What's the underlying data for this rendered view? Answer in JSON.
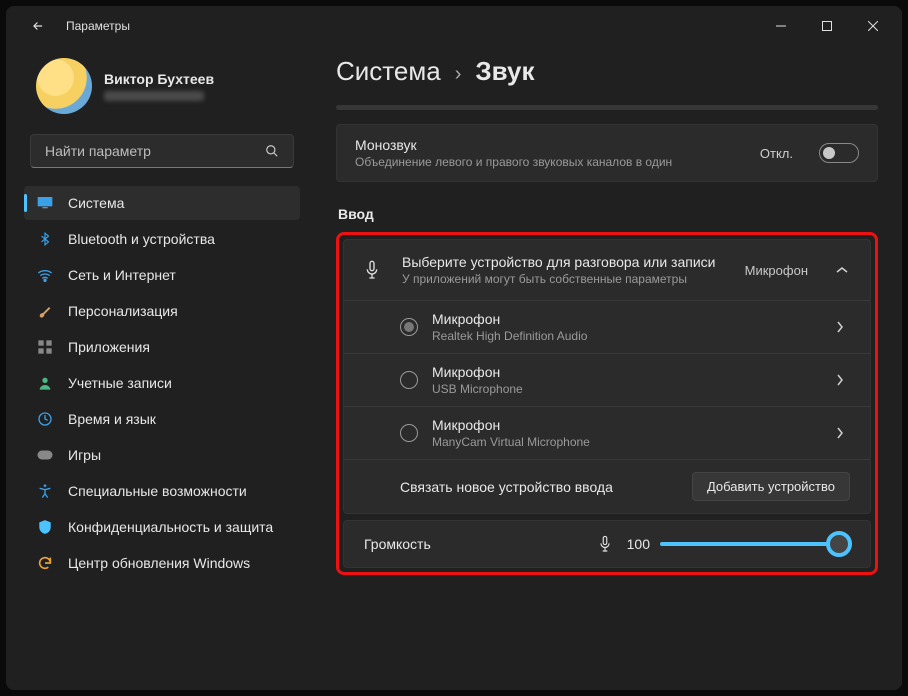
{
  "titlebar": {
    "title": "Параметры"
  },
  "profile": {
    "name": "Виктор Бухтеев"
  },
  "search": {
    "placeholder": "Найти параметр"
  },
  "nav": {
    "items": [
      {
        "label": "Система",
        "icon": "display",
        "active": true
      },
      {
        "label": "Bluetooth и устройства",
        "icon": "bluetooth"
      },
      {
        "label": "Сеть и Интернет",
        "icon": "wifi"
      },
      {
        "label": "Персонализация",
        "icon": "brush"
      },
      {
        "label": "Приложения",
        "icon": "apps"
      },
      {
        "label": "Учетные записи",
        "icon": "person"
      },
      {
        "label": "Время и язык",
        "icon": "globe"
      },
      {
        "label": "Игры",
        "icon": "gamepad"
      },
      {
        "label": "Специальные возможности",
        "icon": "accessibility"
      },
      {
        "label": "Конфиденциальность и защита",
        "icon": "shield"
      },
      {
        "label": "Центр обновления Windows",
        "icon": "update"
      }
    ]
  },
  "breadcrumb": {
    "parent": "Система",
    "current": "Звук"
  },
  "mono": {
    "title": "Монозвук",
    "sub": "Объединение левого и правого звуковых каналов в один",
    "state": "Откл."
  },
  "input": {
    "section": "Ввод",
    "head_title": "Выберите устройство для разговора или записи",
    "head_sub": "У приложений могут быть собственные параметры",
    "head_right": "Микрофон",
    "devices": [
      {
        "title": "Микрофон",
        "sub": "Realtek High Definition Audio",
        "selected": true
      },
      {
        "title": "Микрофон",
        "sub": "USB Microphone",
        "selected": false
      },
      {
        "title": "Микрофон",
        "sub": "ManyCam Virtual Microphone",
        "selected": false
      }
    ],
    "pair_label": "Связать новое устройство ввода",
    "pair_button": "Добавить устройство",
    "volume_label": "Громкость",
    "volume_value": "100"
  }
}
